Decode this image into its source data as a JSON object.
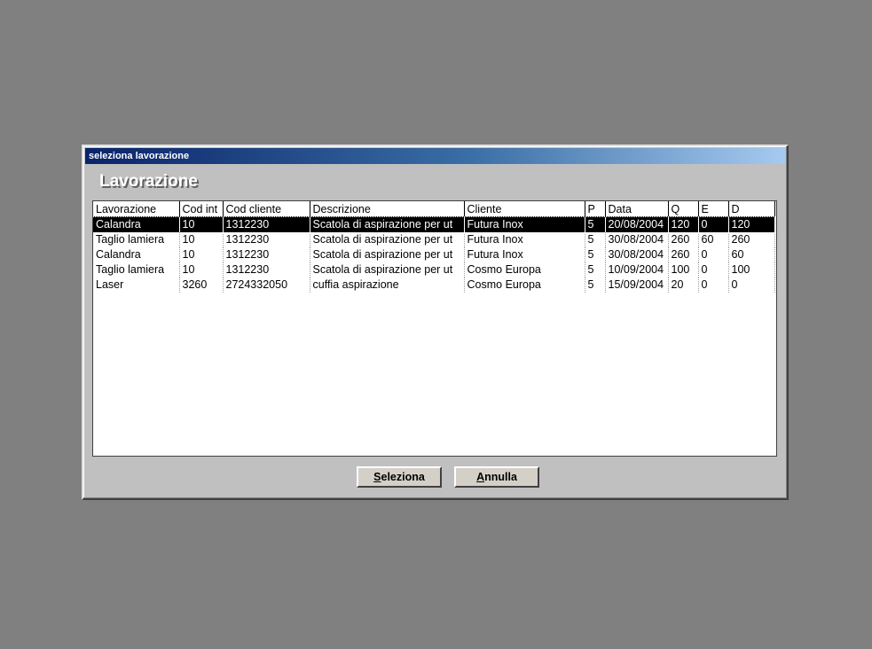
{
  "window": {
    "title": "seleziona lavorazione"
  },
  "heading": "Lavorazione",
  "grid": {
    "columns": [
      "Lavorazione",
      "Cod int",
      "Cod cliente",
      "Descrizione",
      "Cliente",
      "P",
      "Data",
      "Q",
      "E",
      "D"
    ],
    "selected_row": 0,
    "rows": [
      [
        "Calandra",
        "10",
        "1312230",
        "Scatola di aspirazione per ut",
        "Futura Inox",
        "5",
        "20/08/2004",
        "120",
        "0",
        "120"
      ],
      [
        "Taglio lamiera",
        "10",
        "1312230",
        "Scatola di aspirazione per ut",
        "Futura Inox",
        "5",
        "30/08/2004",
        "260",
        "60",
        "260"
      ],
      [
        "Calandra",
        "10",
        "1312230",
        "Scatola di aspirazione per ut",
        "Futura Inox",
        "5",
        "30/08/2004",
        "260",
        "0",
        "60"
      ],
      [
        "Taglio lamiera",
        "10",
        "1312230",
        "Scatola di aspirazione per ut",
        "Cosmo Europa",
        "5",
        "10/09/2004",
        "100",
        "0",
        "100"
      ],
      [
        "Laser",
        "3260",
        "2724332050",
        "cuffia aspirazione",
        "Cosmo Europa",
        "5",
        "15/09/2004",
        "20",
        "0",
        "0"
      ]
    ]
  },
  "buttons": {
    "select": {
      "mnemonic": "S",
      "rest": "eleziona"
    },
    "cancel": {
      "mnemonic": "A",
      "rest": "nnulla"
    }
  }
}
